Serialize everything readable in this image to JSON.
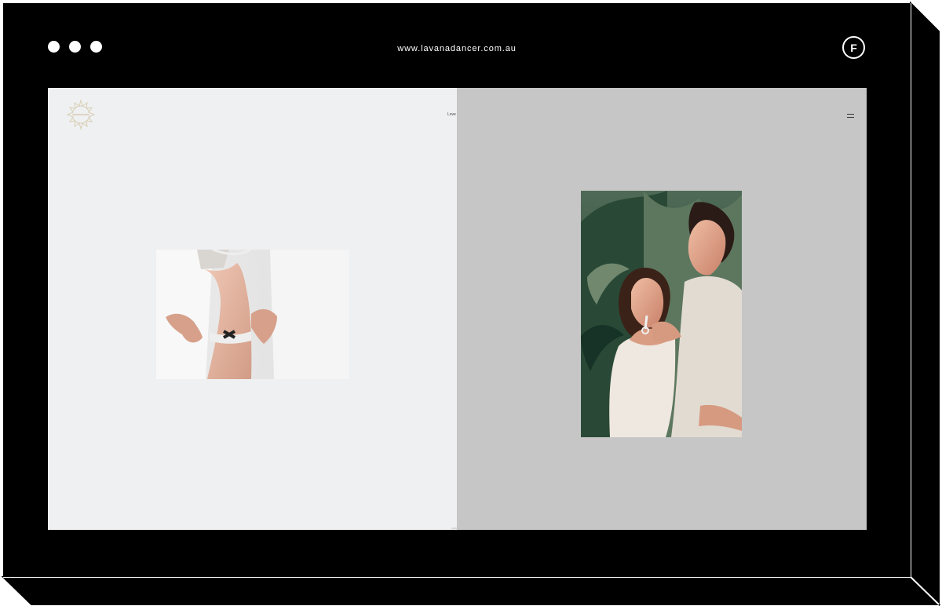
{
  "browser": {
    "url": "www.lavanadancer.com.au",
    "logo_letter": "F"
  },
  "site": {
    "nav_label": "Love",
    "logo_icon": "sun-logo-icon",
    "menu_icon": "hamburger-menu-icon",
    "grid_icon": "grid-icon"
  },
  "colors": {
    "frame": "#000000",
    "left_panel": "#eff0f2",
    "right_panel": "#c6c6c6"
  }
}
